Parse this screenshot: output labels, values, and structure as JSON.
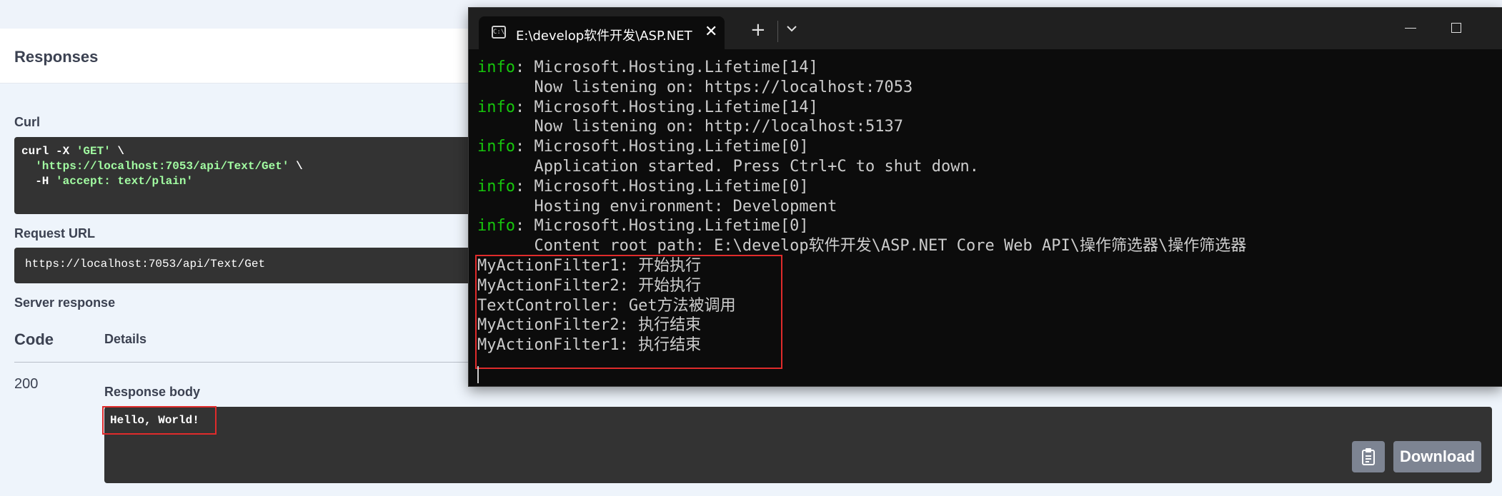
{
  "swagger": {
    "responses_title": "Responses",
    "curl_label": "Curl",
    "curl_lines": [
      {
        "pre": "curl -X ",
        "str": "'GET'",
        "post": " \\"
      },
      {
        "pre": "  ",
        "str": "'https://localhost:7053/api/Text/Get'",
        "post": " \\"
      },
      {
        "pre": "  -H ",
        "str": "'accept: text/plain'",
        "post": ""
      }
    ],
    "request_url_label": "Request URL",
    "request_url": "https://localhost:7053/api/Text/Get",
    "server_response_label": "Server response",
    "code_header": "Code",
    "details_header": "Details",
    "code_value": "200",
    "response_body_label": "Response body",
    "response_body": "Hello, World!",
    "download_label": "Download",
    "copy_icon": "clipboard-icon"
  },
  "terminal": {
    "tab_title": "E:\\develop软件开发\\ASP.NET",
    "tab_icon": "terminal-icon",
    "lines": [
      {
        "level": "info",
        "text": ": Microsoft.Hosting.Lifetime[14]"
      },
      {
        "level": "",
        "text": "      Now listening on: https://localhost:7053"
      },
      {
        "level": "info",
        "text": ": Microsoft.Hosting.Lifetime[14]"
      },
      {
        "level": "",
        "text": "      Now listening on: http://localhost:5137"
      },
      {
        "level": "info",
        "text": ": Microsoft.Hosting.Lifetime[0]"
      },
      {
        "level": "",
        "text": "      Application started. Press Ctrl+C to shut down."
      },
      {
        "level": "info",
        "text": ": Microsoft.Hosting.Lifetime[0]"
      },
      {
        "level": "",
        "text": "      Hosting environment: Development"
      },
      {
        "level": "info",
        "text": ": Microsoft.Hosting.Lifetime[0]"
      },
      {
        "level": "",
        "text": "      Content root path: E:\\develop软件开发\\ASP.NET Core Web API\\操作筛选器\\操作筛选器"
      },
      {
        "level": "",
        "text": "MyActionFilter1: 开始执行"
      },
      {
        "level": "",
        "text": "MyActionFilter2: 开始执行"
      },
      {
        "level": "",
        "text": "TextController: Get方法被调用"
      },
      {
        "level": "",
        "text": "MyActionFilter2: 执行结束"
      },
      {
        "level": "",
        "text": "MyActionFilter1: 执行结束"
      }
    ]
  },
  "colors": {
    "info_green": "#16c60c",
    "highlight_red": "#e02b2b",
    "curl_string_green": "#a2fca2"
  }
}
